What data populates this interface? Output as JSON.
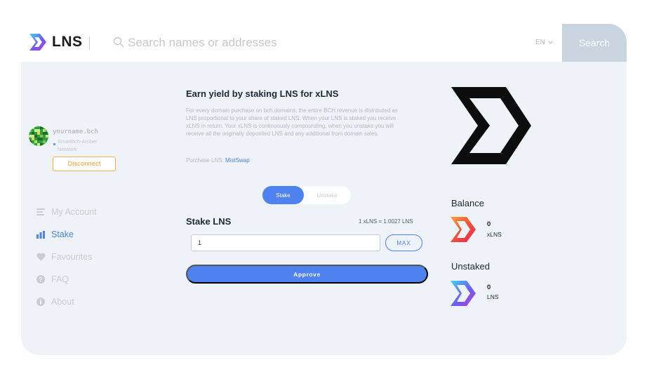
{
  "header": {
    "logo_text": "LNS",
    "search_placeholder": "Search names or addresses",
    "language": "EN",
    "search_button": "Search"
  },
  "user": {
    "name": "yourname.bch",
    "network": "Smartbch-Amber Network",
    "disconnect_label": "Disconnect"
  },
  "nav": {
    "items": [
      {
        "label": "My Account",
        "icon": "list-icon",
        "active": false
      },
      {
        "label": "Stake",
        "icon": "bar-chart-icon",
        "active": true
      },
      {
        "label": "Favourites",
        "icon": "heart-icon",
        "active": false
      },
      {
        "label": "FAQ",
        "icon": "question-icon",
        "active": false
      },
      {
        "label": "About",
        "icon": "info-icon",
        "active": false
      }
    ]
  },
  "main": {
    "title": "Earn yield by staking LNS for xLNS",
    "description": "For every domain purchase on bch.domains, the entire BCH revenue is distributed as LNS proportional to your share of staked LNS. When your LNS is staked you receive xLNS in return. Your xLNS is continuously compounding, when you unstake you will receive all the originally deposited LNS and any additional from domain sales.",
    "purchase_label": "Purchase LNS: ",
    "purchase_link": "MistSwap",
    "toggle": {
      "stake": "Stake",
      "unstake": "Unstake",
      "selected": "Stake"
    },
    "stake_title": "Stake LNS",
    "rate": "1 xLNS = 1.0027 LNS",
    "amount_value": "1",
    "max_label": "MAX",
    "approve_label": "Approve"
  },
  "side": {
    "balance_title": "Balance",
    "balance_value": "0",
    "balance_unit": "xLNS",
    "unstaked_title": "Unstaked",
    "unstaked_value": "0",
    "unstaked_unit": "LNS"
  },
  "colors": {
    "accent": "#4e82f0",
    "disconnect": "#f0a23b",
    "background": "#edf3f9",
    "search_button": "#cad4e0"
  }
}
